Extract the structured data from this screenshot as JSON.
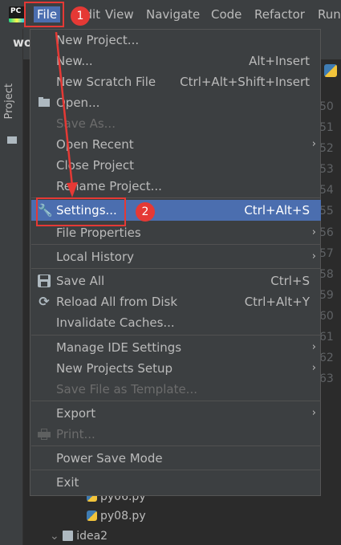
{
  "menubar": {
    "app_icon_label": "PC",
    "menus": [
      "File",
      "Edit",
      "View",
      "Navigate",
      "Code",
      "Refactor",
      "Run"
    ]
  },
  "toolwindow": {
    "project_tab": "Project"
  },
  "background": {
    "project_title": "wo",
    "line_numbers": [
      "50",
      "51",
      "52",
      "53",
      "54",
      "55",
      "56",
      "57",
      "58",
      "59",
      "60",
      "61",
      "62",
      "63"
    ],
    "tree": [
      "py06.py",
      "py08.py",
      "idea2"
    ]
  },
  "file_menu": {
    "items": [
      {
        "label": "New Project...",
        "shortcut": "",
        "submenu": false,
        "disabled": false,
        "icon": ""
      },
      {
        "label": "New...",
        "shortcut": "Alt+Insert",
        "submenu": false,
        "disabled": false,
        "icon": ""
      },
      {
        "label": "New Scratch File",
        "shortcut": "Ctrl+Alt+Shift+Insert",
        "submenu": false,
        "disabled": false,
        "icon": ""
      },
      {
        "label": "Open...",
        "shortcut": "",
        "submenu": false,
        "disabled": false,
        "icon": "folder-open-icon"
      },
      {
        "label": "Save As...",
        "shortcut": "",
        "submenu": false,
        "disabled": true,
        "icon": ""
      },
      {
        "label": "Open Recent",
        "shortcut": "",
        "submenu": true,
        "disabled": false,
        "icon": ""
      },
      {
        "label": "Close Project",
        "shortcut": "",
        "submenu": false,
        "disabled": false,
        "icon": ""
      },
      {
        "label": "Rename Project...",
        "shortcut": "",
        "submenu": false,
        "disabled": false,
        "icon": ""
      },
      {
        "label": "Settings...",
        "shortcut": "Ctrl+Alt+S",
        "submenu": false,
        "disabled": false,
        "icon": "wrench-icon",
        "selected": true
      },
      {
        "label": "File Properties",
        "shortcut": "",
        "submenu": true,
        "disabled": false,
        "icon": ""
      },
      {
        "label": "Local History",
        "shortcut": "",
        "submenu": true,
        "disabled": false,
        "icon": ""
      },
      {
        "label": "Save All",
        "shortcut": "Ctrl+S",
        "submenu": false,
        "disabled": false,
        "icon": "save-icon"
      },
      {
        "label": "Reload All from Disk",
        "shortcut": "Ctrl+Alt+Y",
        "submenu": false,
        "disabled": false,
        "icon": "reload-icon"
      },
      {
        "label": "Invalidate Caches...",
        "shortcut": "",
        "submenu": false,
        "disabled": false,
        "icon": ""
      },
      {
        "label": "Manage IDE Settings",
        "shortcut": "",
        "submenu": true,
        "disabled": false,
        "icon": ""
      },
      {
        "label": "New Projects Setup",
        "shortcut": "",
        "submenu": true,
        "disabled": false,
        "icon": ""
      },
      {
        "label": "Save File as Template...",
        "shortcut": "",
        "submenu": false,
        "disabled": true,
        "icon": ""
      },
      {
        "label": "Export",
        "shortcut": "",
        "submenu": true,
        "disabled": false,
        "icon": ""
      },
      {
        "label": "Print...",
        "shortcut": "",
        "submenu": false,
        "disabled": true,
        "icon": "printer-icon"
      },
      {
        "label": "Power Save Mode",
        "shortcut": "",
        "submenu": false,
        "disabled": false,
        "icon": ""
      },
      {
        "label": "Exit",
        "shortcut": "",
        "submenu": false,
        "disabled": false,
        "icon": ""
      }
    ],
    "submenu_glyph": "›"
  },
  "annotations": {
    "step1": "1",
    "step2": "2",
    "accent": "#e53935"
  },
  "colors": {
    "menu_bg": "#3c3f41",
    "selection": "#4b6eaf",
    "text": "#bbbbbb",
    "disabled_text": "#6c6c6c"
  }
}
